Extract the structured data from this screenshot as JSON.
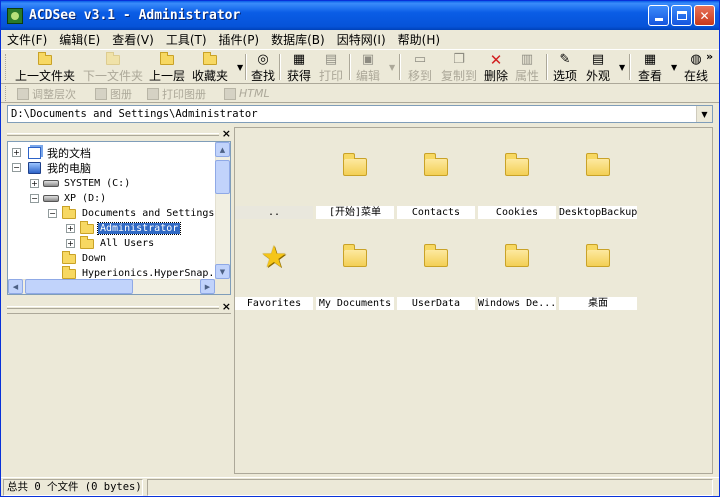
{
  "window": {
    "title": "ACDSee v3.1 - Administrator"
  },
  "menu": [
    "文件(F)",
    "编辑(E)",
    "查看(V)",
    "工具(T)",
    "插件(P)",
    "数据库(B)",
    "因特网(I)",
    "帮助(H)"
  ],
  "toolbar": {
    "up_folder": "上一文件夹",
    "next_folder": "下一文件夹",
    "up_level": "上一层",
    "favorites": "收藏夹",
    "find": "查找",
    "acquire": "获得",
    "print": "打印",
    "edit": "编辑",
    "move_to": "移到",
    "copy_to": "复制到",
    "delete": "删除",
    "properties": "属性",
    "options": "选项",
    "appearance": "外观",
    "view": "查看",
    "more": "在线",
    "overflow": "»"
  },
  "toolbar2": {
    "adjust": "调整层次",
    "album": "图册",
    "print_album": "打印图册",
    "html": "HTML"
  },
  "address": {
    "path": "D:\\Documents and Settings\\Administrator"
  },
  "tree": {
    "items": [
      {
        "label": "我的文档"
      },
      {
        "label": "我的电脑"
      },
      {
        "label": "SYSTEM (C:)"
      },
      {
        "label": "XP (D:)"
      },
      {
        "label": "Documents and Settings"
      },
      {
        "label": "Administrator"
      },
      {
        "label": "All Users"
      },
      {
        "label": "Down"
      },
      {
        "label": "Hyperionics.HyperSnap.I"
      }
    ]
  },
  "files": [
    {
      "name": ".."
    },
    {
      "name": "[开始]菜单"
    },
    {
      "name": "Contacts"
    },
    {
      "name": "Cookies"
    },
    {
      "name": "DesktopBackup"
    },
    {
      "name": "Favorites"
    },
    {
      "name": "My Documents"
    },
    {
      "name": "UserData"
    },
    {
      "name": "Windows De..."
    },
    {
      "name": "桌面"
    }
  ],
  "status": {
    "summary": "总共 0 个文件 (0 bytes)"
  },
  "colors": {
    "titlebar": "#0a5de6",
    "selection": "#316ac5",
    "folder": "#f7d862"
  }
}
